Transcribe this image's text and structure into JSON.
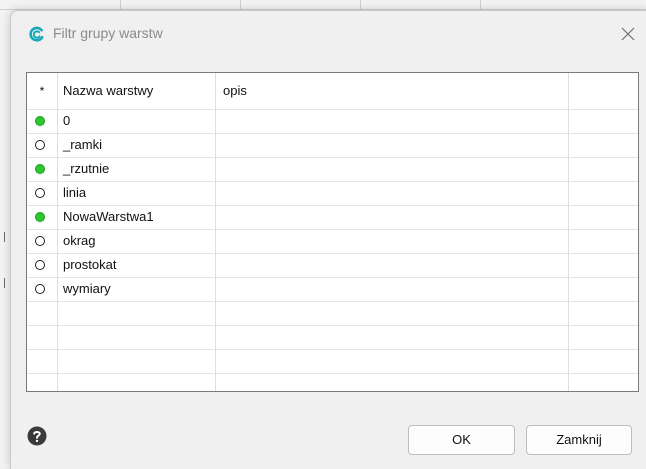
{
  "window": {
    "title": "Filtr grupy warstw",
    "app_icon": "app-logo-icon",
    "close_icon": "close-icon"
  },
  "grid": {
    "columns": [
      "*",
      "Nazwa warstwy",
      "opis"
    ],
    "rows": [
      {
        "status": "on",
        "name": "0",
        "description": ""
      },
      {
        "status": "off",
        "name": "_ramki",
        "description": ""
      },
      {
        "status": "on",
        "name": "_rzutnie",
        "description": ""
      },
      {
        "status": "off",
        "name": "linia",
        "description": ""
      },
      {
        "status": "on",
        "name": "NowaWarstwa1",
        "description": ""
      },
      {
        "status": "off",
        "name": "okrag",
        "description": ""
      },
      {
        "status": "off",
        "name": "prostokat",
        "description": ""
      },
      {
        "status": "off",
        "name": "wymiary",
        "description": ""
      }
    ]
  },
  "footer": {
    "help_icon": "help-icon",
    "ok_label": "OK",
    "close_label": "Zamknij"
  },
  "colors": {
    "status_on": "#2ec82e",
    "status_off": "#ffffff",
    "accent": "#1aa8b8"
  }
}
